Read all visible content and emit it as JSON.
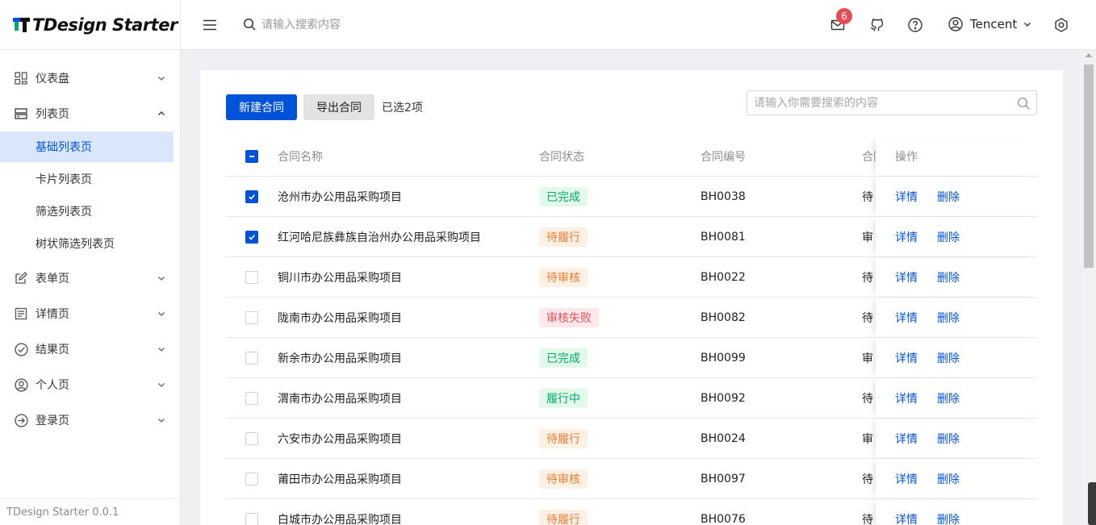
{
  "app": {
    "logo_text": "TDesign Starter",
    "version": "TDesign Starter 0.0.1"
  },
  "header": {
    "search_placeholder": "请输入搜索内容",
    "notification_count": "6",
    "user_name": "Tencent"
  },
  "sidebar": {
    "items": [
      {
        "label": "仪表盘",
        "icon": "dashboard-icon"
      },
      {
        "label": "列表页",
        "icon": "list-icon",
        "expanded": true,
        "children": [
          "基础列表页",
          "卡片列表页",
          "筛选列表页",
          "树状筛选列表页"
        ],
        "active_child": 0
      },
      {
        "label": "表单页",
        "icon": "edit-icon"
      },
      {
        "label": "详情页",
        "icon": "detail-icon"
      },
      {
        "label": "结果页",
        "icon": "check-circle-icon"
      },
      {
        "label": "个人页",
        "icon": "user-circle-icon"
      },
      {
        "label": "登录页",
        "icon": "login-icon"
      }
    ]
  },
  "toolbar": {
    "new_label": "新建合同",
    "export_label": "导出合同",
    "selected_text": "已选2项",
    "search_placeholder": "请输入你需要搜索的内容"
  },
  "table": {
    "columns": [
      "合同名称",
      "合同状态",
      "合同编号",
      "合同",
      "操作"
    ],
    "rows": [
      {
        "checked": true,
        "name": "沧州市办公用品采购项目",
        "status": "已完成",
        "status_type": "done",
        "no": "BH0038",
        "type": "待"
      },
      {
        "checked": true,
        "name": "红河哈尼族彝族自治州办公用品采购项目",
        "status": "待履行",
        "status_type": "pending",
        "no": "BH0081",
        "type": "审"
      },
      {
        "checked": false,
        "name": "铜川市办公用品采购项目",
        "status": "待审核",
        "status_type": "pending",
        "no": "BH0022",
        "type": "待"
      },
      {
        "checked": false,
        "name": "陇南市办公用品采购项目",
        "status": "审核失败",
        "status_type": "fail",
        "no": "BH0082",
        "type": "待"
      },
      {
        "checked": false,
        "name": "新余市办公用品采购项目",
        "status": "已完成",
        "status_type": "done",
        "no": "BH0099",
        "type": "审"
      },
      {
        "checked": false,
        "name": "渭南市办公用品采购项目",
        "status": "履行中",
        "status_type": "progress",
        "no": "BH0092",
        "type": "待"
      },
      {
        "checked": false,
        "name": "六安市办公用品采购项目",
        "status": "待履行",
        "status_type": "pending",
        "no": "BH0024",
        "type": "审"
      },
      {
        "checked": false,
        "name": "莆田市办公用品采购项目",
        "status": "待审核",
        "status_type": "pending",
        "no": "BH0097",
        "type": "待"
      },
      {
        "checked": false,
        "name": "白城市办公用品采购项目",
        "status": "待履行",
        "status_type": "pending",
        "no": "BH0076",
        "type": "待"
      }
    ],
    "op_detail": "详情",
    "op_delete": "删除"
  }
}
